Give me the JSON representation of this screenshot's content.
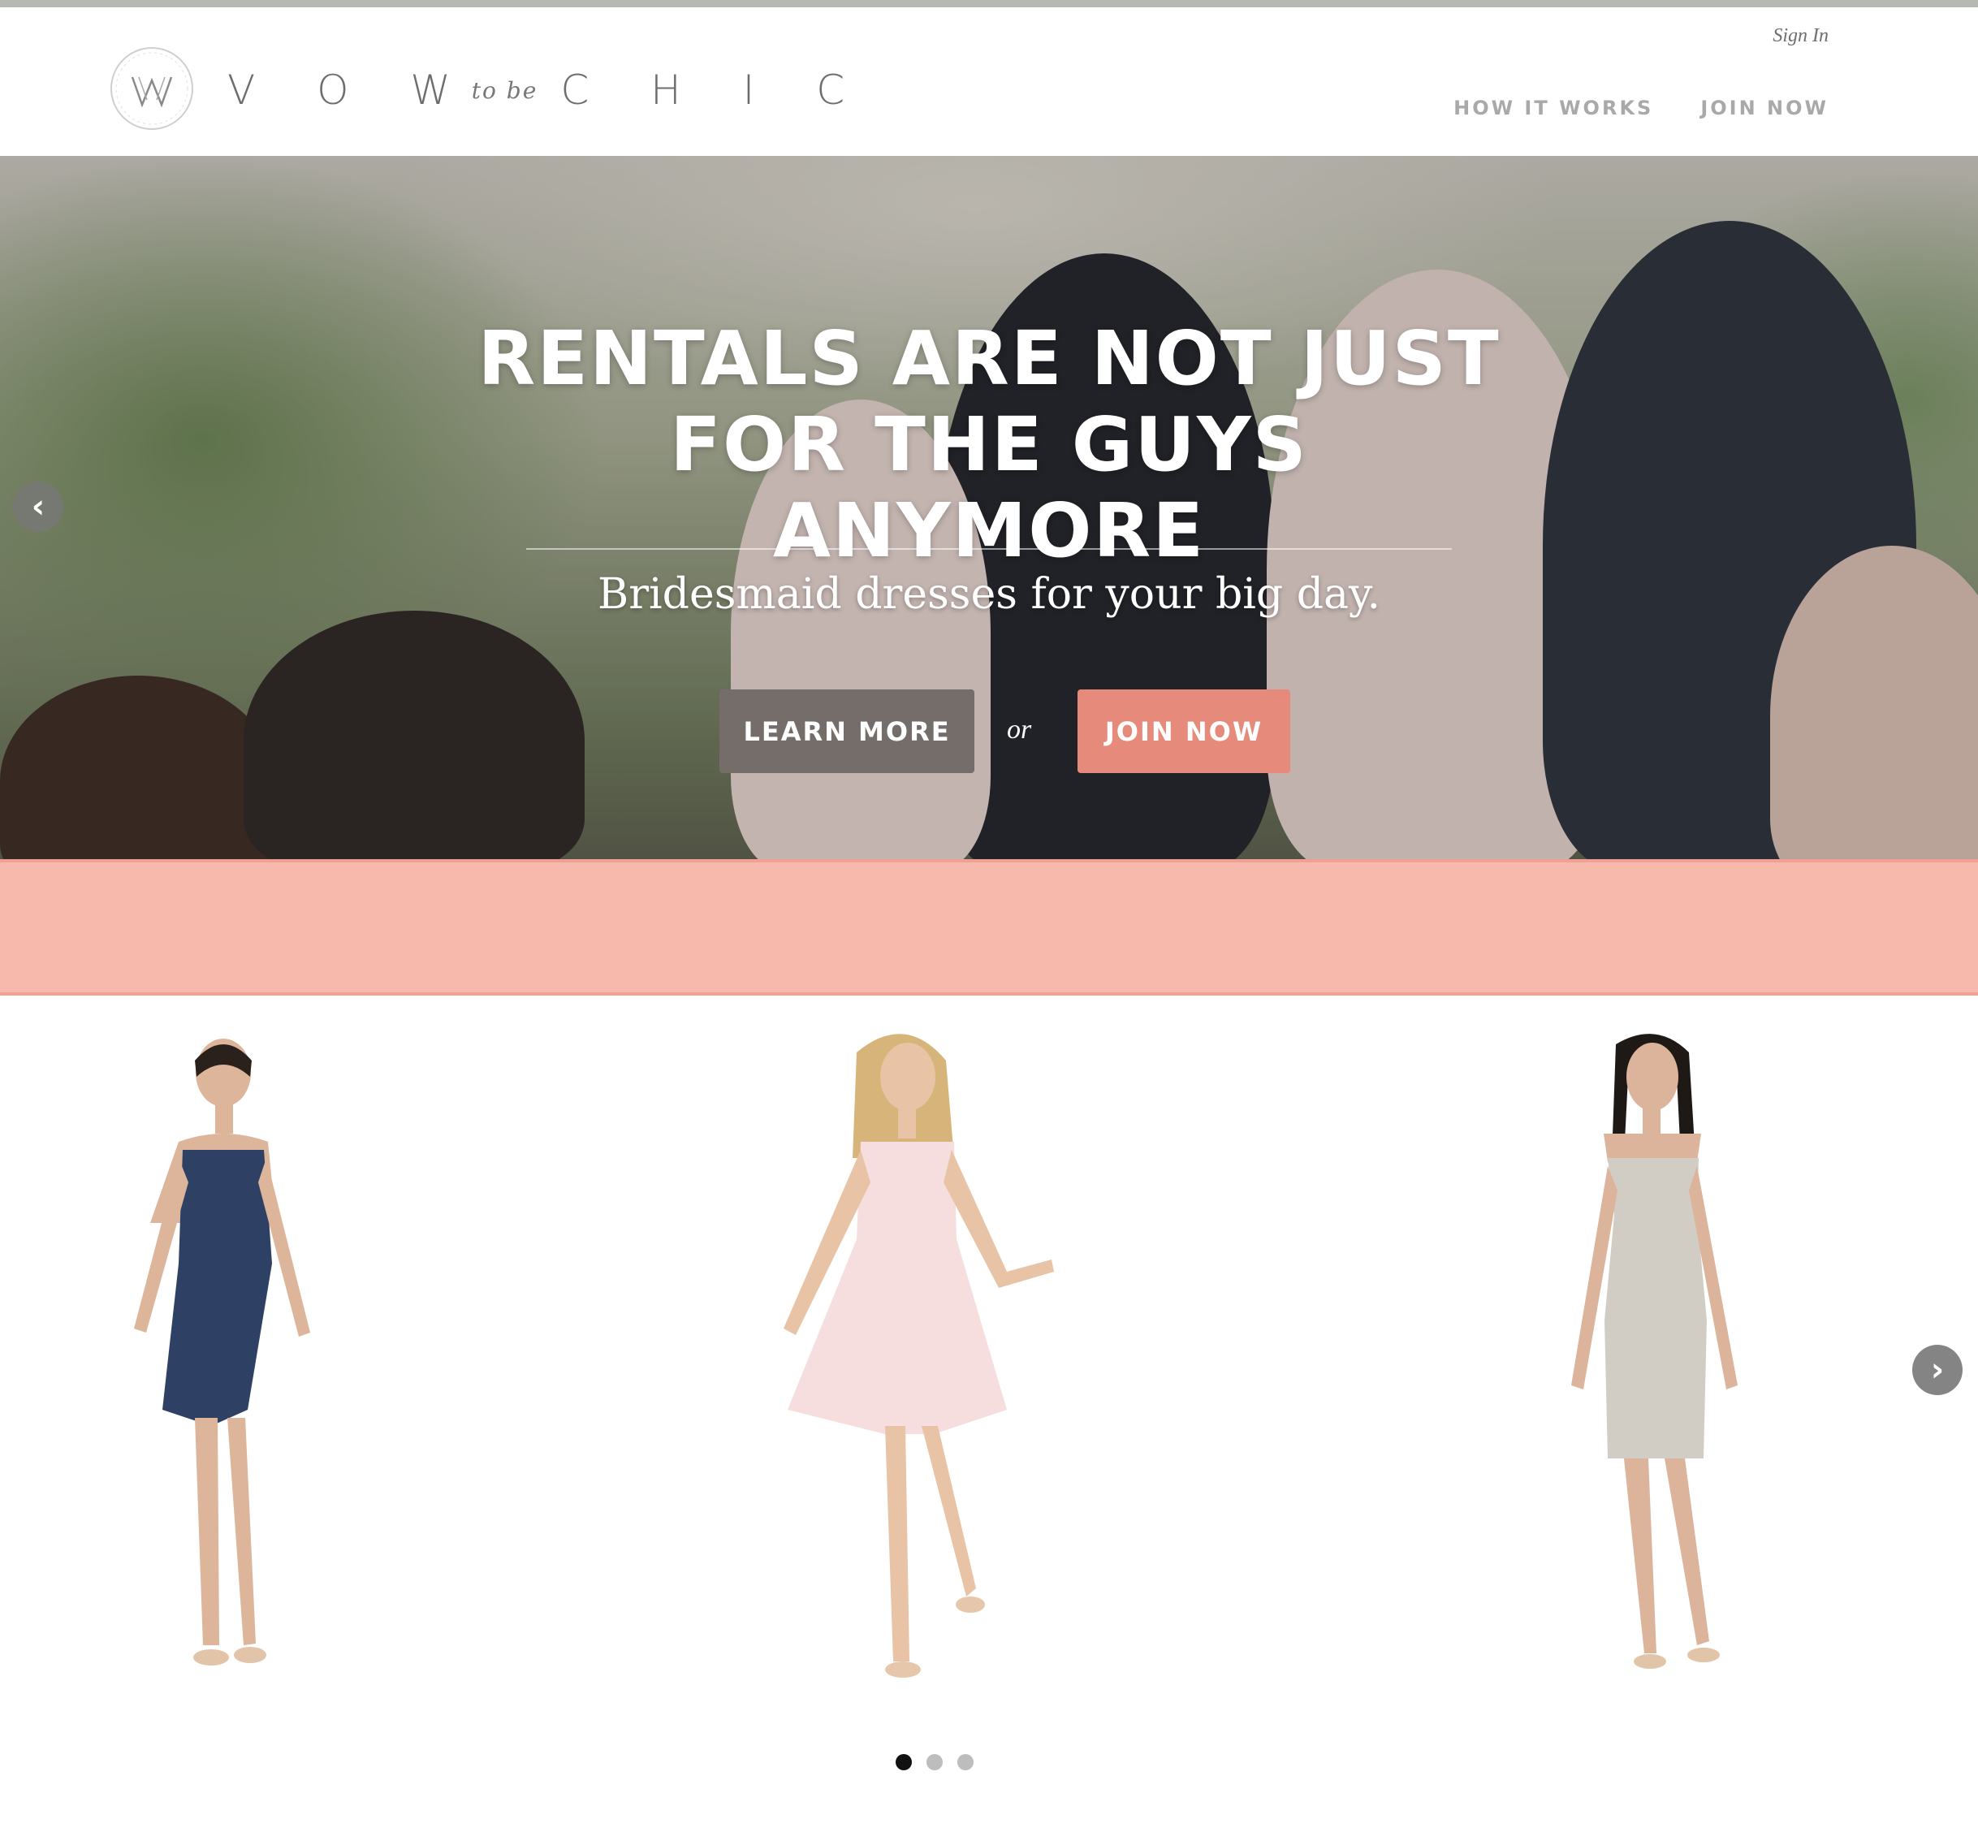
{
  "header": {
    "brand": {
      "word1": "V O W",
      "tobe": "to be",
      "word2": "C H I C",
      "monogram": "VW"
    },
    "sign_in": "Sign In",
    "nav": [
      {
        "label": "HOW IT WORKS"
      },
      {
        "label": "JOIN NOW"
      }
    ]
  },
  "hero": {
    "headline_line1": "RENTALS ARE NOT JUST",
    "headline_line2": "FOR THE GUYS",
    "headline_line3": "ANYMORE",
    "subheading": "Bridesmaid dresses for your big day.",
    "learn_more": "LEARN MORE",
    "or": "or",
    "join_now": "JOIN NOW",
    "prev_icon": "chevron-left-icon"
  },
  "products": {
    "items": [
      {
        "dress_color": "#2e4063",
        "skin": "#dcb59a",
        "hair": "#2a211c"
      },
      {
        "dress_color": "#f5dedd",
        "skin": "#e8c3a5",
        "hair": "#d7b57a"
      },
      {
        "dress_color": "#d1cdc5",
        "skin": "#dcb49b",
        "hair": "#1f1916"
      }
    ],
    "next_icon": "chevron-right-icon",
    "pagination": {
      "count": 3,
      "active": 1
    }
  },
  "colors": {
    "accent_coral": "#e68b7b",
    "pink_band": "#f8b9ad",
    "button_taupe": "#756d69",
    "nav_gray": "#a9a9a9"
  }
}
